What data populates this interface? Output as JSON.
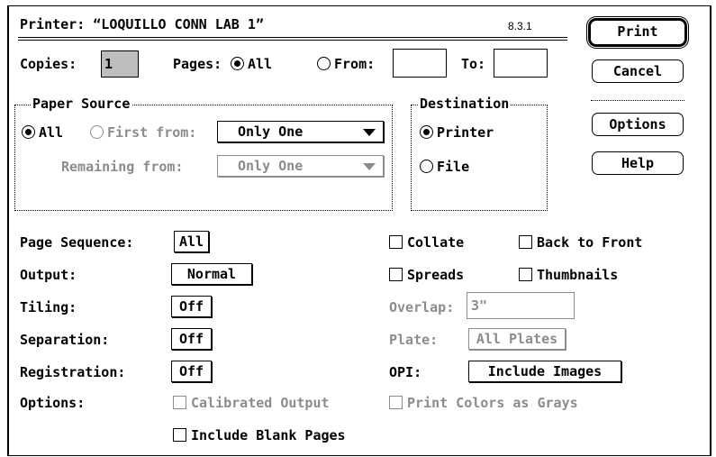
{
  "title": {
    "printer_label": "Printer: “LOQUILLO CONN LAB 1”",
    "version": "8.3.1"
  },
  "buttons": {
    "print": "Print",
    "cancel": "Cancel",
    "options": "Options",
    "help": "Help"
  },
  "copies": {
    "label": "Copies:",
    "value": "1"
  },
  "pages": {
    "label": "Pages:",
    "all": "All",
    "from": "From:",
    "to": "To:",
    "from_value": "",
    "to_value": "",
    "selected": "All"
  },
  "paper_source": {
    "title": "Paper Source",
    "all": "All",
    "first_from": "First from:",
    "first_value": "Only One",
    "remaining_from": "Remaining from:",
    "remaining_value": "Only One",
    "selected": "All"
  },
  "destination": {
    "title": "Destination",
    "printer": "Printer",
    "file": "File",
    "selected": "Printer"
  },
  "settings": {
    "page_sequence_label": "Page Sequence:",
    "page_sequence_value": "All",
    "output_label": "Output:",
    "output_value": "Normal",
    "tiling_label": "Tiling:",
    "tiling_value": "Off",
    "separation_label": "Separation:",
    "separation_value": "Off",
    "registration_label": "Registration:",
    "registration_value": "Off",
    "options_label": "Options:",
    "calibrated_output": "Calibrated Output",
    "include_blank_pages": "Include Blank Pages"
  },
  "checks": {
    "collate": "Collate",
    "back_to_front": "Back to Front",
    "spreads": "Spreads",
    "thumbnails": "Thumbnails",
    "print_colors_as_grays": "Print Colors as Grays"
  },
  "overlap": {
    "label": "Overlap:",
    "value": "3\""
  },
  "plate": {
    "label": "Plate:",
    "value": "All Plates"
  },
  "opi": {
    "label": "OPI:",
    "value": "Include Images"
  }
}
